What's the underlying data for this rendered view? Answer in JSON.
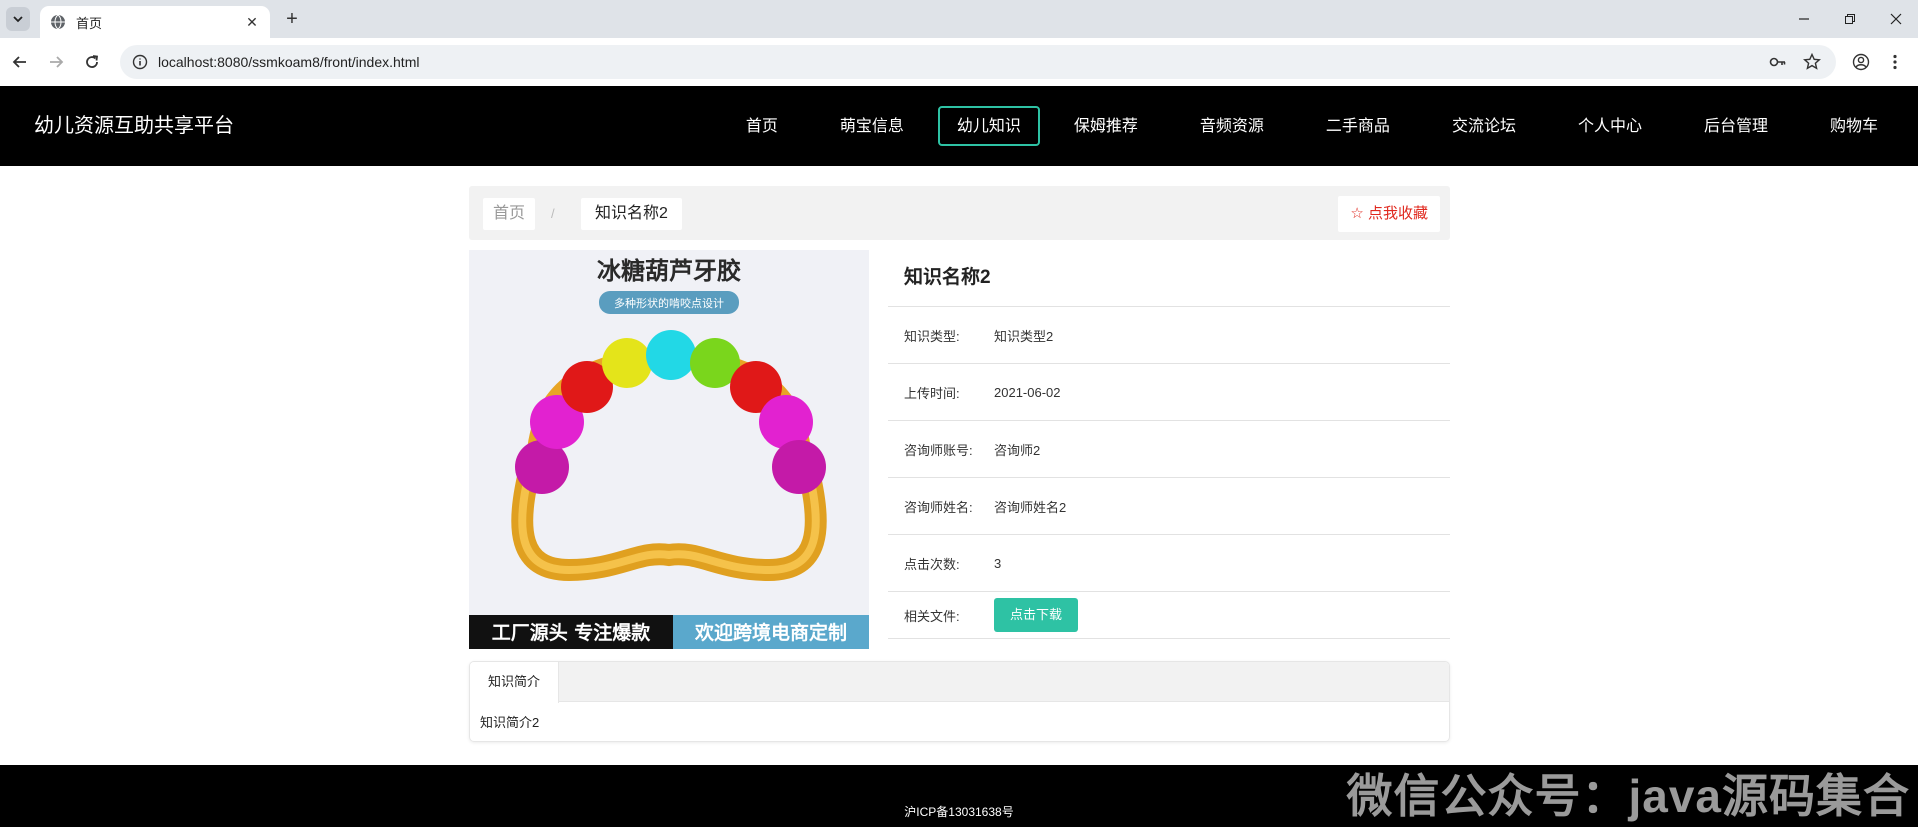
{
  "browser": {
    "tab_title": "首页",
    "url": "localhost:8080/ssmkoam8/front/index.html"
  },
  "site": {
    "title": "幼儿资源互助共享平台",
    "nav": [
      "首页",
      "萌宝信息",
      "幼儿知识",
      "保姆推荐",
      "音频资源",
      "二手商品",
      "交流论坛",
      "个人中心",
      "后台管理",
      "购物车"
    ],
    "active_nav": "幼儿知识"
  },
  "breadcrumb": {
    "home": "首页",
    "separator": "/",
    "current": "知识名称2"
  },
  "favorite_label": "☆ 点我收藏",
  "product_image": {
    "headline": "冰糖葫芦牙胶",
    "tag": "多种形状的啃咬点设计",
    "banner_left": "工厂源头 专注爆款",
    "banner_right": "欢迎跨境电商定制"
  },
  "detail": {
    "title": "知识名称2",
    "rows": [
      {
        "label": "知识类型:",
        "value": "知识类型2"
      },
      {
        "label": "上传时间:",
        "value": "2021-06-02"
      },
      {
        "label": "咨询师账号:",
        "value": "咨询师2"
      },
      {
        "label": "咨询师姓名:",
        "value": "咨询师姓名2"
      },
      {
        "label": "点击次数:",
        "value": "3"
      }
    ],
    "file_label": "相关文件:",
    "download_label": "点击下载"
  },
  "intro_tab": {
    "label": "知识简介",
    "content": "知识简介2"
  },
  "footer": {
    "icp": "沪ICP备13031638号",
    "watermark": "微信公众号：java源码集合"
  },
  "colors": {
    "accent": "#2ec2a4",
    "header_bg": "#000000",
    "favorite": "#e0281e"
  }
}
